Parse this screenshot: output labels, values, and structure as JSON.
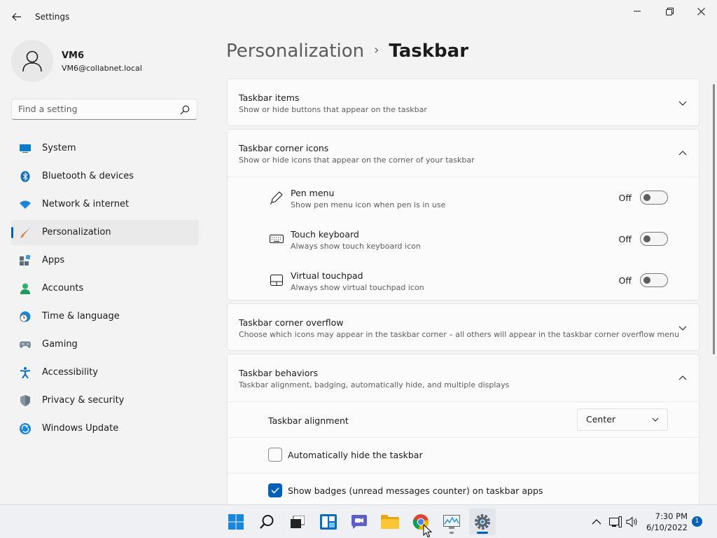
{
  "window": {
    "title": "Settings"
  },
  "profile": {
    "name": "VM6",
    "email": "VM6@collabnet.local"
  },
  "search": {
    "placeholder": "Find a setting"
  },
  "sidebar": {
    "items": [
      {
        "label": "System",
        "icon": "system-icon"
      },
      {
        "label": "Bluetooth & devices",
        "icon": "bluetooth-icon"
      },
      {
        "label": "Network & internet",
        "icon": "wifi-icon"
      },
      {
        "label": "Personalization",
        "icon": "brush-icon",
        "selected": true
      },
      {
        "label": "Apps",
        "icon": "apps-icon"
      },
      {
        "label": "Accounts",
        "icon": "person-icon"
      },
      {
        "label": "Time & language",
        "icon": "globe-clock-icon"
      },
      {
        "label": "Gaming",
        "icon": "gamepad-icon"
      },
      {
        "label": "Accessibility",
        "icon": "accessibility-icon"
      },
      {
        "label": "Privacy & security",
        "icon": "shield-icon"
      },
      {
        "label": "Windows Update",
        "icon": "update-icon"
      }
    ]
  },
  "breadcrumb": {
    "parent": "Personalization",
    "separator": "›",
    "current": "Taskbar"
  },
  "sections": {
    "items": {
      "title": "Taskbar items",
      "subtitle": "Show or hide buttons that appear on the taskbar"
    },
    "corner_icons": {
      "title": "Taskbar corner icons",
      "subtitle": "Show or hide icons that appear on the corner of your taskbar",
      "rows": [
        {
          "title": "Pen menu",
          "subtitle": "Show pen menu icon when pen is in use",
          "state": "Off",
          "icon": "pen-icon"
        },
        {
          "title": "Touch keyboard",
          "subtitle": "Always show touch keyboard icon",
          "state": "Off",
          "icon": "keyboard-icon"
        },
        {
          "title": "Virtual touchpad",
          "subtitle": "Always show virtual touchpad icon",
          "state": "Off",
          "icon": "touchpad-icon"
        }
      ]
    },
    "overflow": {
      "title": "Taskbar corner overflow",
      "subtitle": "Choose which icons may appear in the taskbar corner – all others will appear in the taskbar corner overflow menu"
    },
    "behaviors": {
      "title": "Taskbar behaviors",
      "subtitle": "Taskbar alignment, badging, automatically hide, and multiple displays",
      "alignment_label": "Taskbar alignment",
      "alignment_value": "Center",
      "auto_hide_label": "Automatically hide the taskbar",
      "auto_hide_checked": false,
      "badges_label": "Show badges (unread messages counter) on taskbar apps",
      "badges_checked": true
    }
  },
  "taskbar": {
    "apps": [
      "start-icon",
      "search-icon",
      "task-view-icon",
      "widgets-icon",
      "chat-icon",
      "file-explorer-icon",
      "chrome-icon",
      "resource-monitor-icon",
      "settings-icon"
    ],
    "time": "7:30 PM",
    "date": "6/10/2022",
    "notification_count": "1"
  },
  "colors": {
    "accent": "#005fb8",
    "background": "#f3f3f3",
    "card": "#fbfbfb"
  }
}
